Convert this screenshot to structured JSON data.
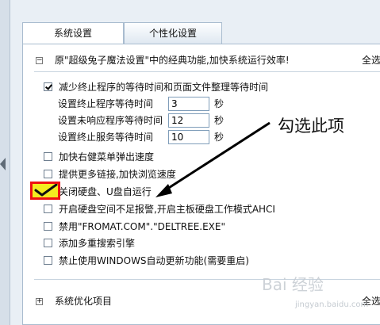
{
  "tabs": [
    {
      "label": "系统设置",
      "active": true
    },
    {
      "label": "个性化设置",
      "active": false
    }
  ],
  "section1": {
    "title": "原\"超级兔子魔法设置\"中的经典功能,加快系统运行效率!",
    "select_all": "全选",
    "expander": "−"
  },
  "options": [
    {
      "label": "减少终止程序的等待时间和页面文件整理等待时间",
      "checked": true
    },
    {
      "label": "加快右健菜单弹出速度",
      "checked": false
    },
    {
      "label": "提供更多链接,加快浏览速度",
      "checked": false
    },
    {
      "label": "关闭硬盘、U盘自运行",
      "checked": true
    },
    {
      "label": "开启硬盘空间不足报警,开启主板硬盘工作模式AHCI",
      "checked": false
    },
    {
      "label": "禁用\"FROMAT.COM\".\"DELTREE.EXE\"",
      "checked": false
    },
    {
      "label": "添加多重搜索引擎",
      "checked": false
    },
    {
      "label": "禁止使用WINDOWS自动更新功能(需要重启)",
      "checked": false
    }
  ],
  "fields": [
    {
      "label": "设置终止程序等待时间",
      "value": "3",
      "unit": "秒"
    },
    {
      "label": "设置未响应程序等待时间",
      "value": "12",
      "unit": "秒"
    },
    {
      "label": "设置终止服务等待时间",
      "value": "10",
      "unit": "秒"
    }
  ],
  "section2": {
    "title": "系统优化项目",
    "select_all": "全选",
    "expander": "+"
  },
  "annotation": {
    "text": "勾选此项",
    "arrow_color": "#000000",
    "highlight_border": "#e11111",
    "highlight_fill": "#f4ec20"
  },
  "watermark": {
    "text": "Bai 经验",
    "subtext": "jingyan.baidu.com"
  }
}
